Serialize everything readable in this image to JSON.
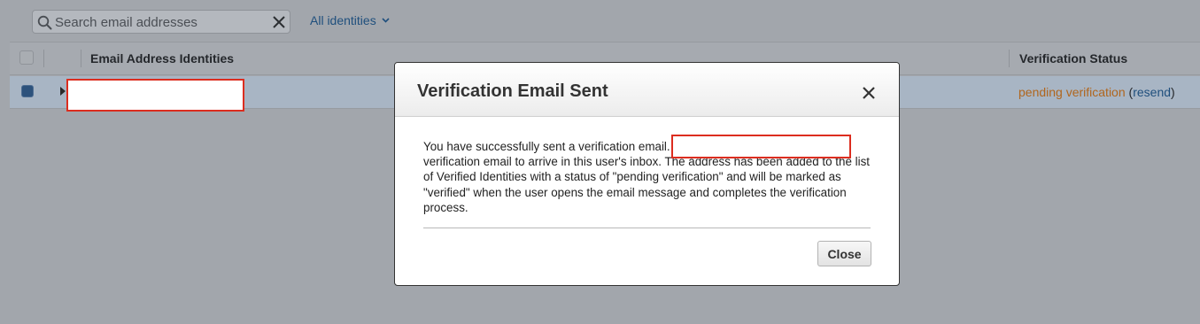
{
  "toolbar": {
    "search_placeholder": "Search email addresses",
    "filter_label": "All identities"
  },
  "table": {
    "columns": [
      "Email Address Identities",
      "Verification Status"
    ],
    "rows": [
      {
        "email": "",
        "status": "pending verification",
        "resend_label": "resend",
        "open_paren": "(",
        "close_paren": ")"
      }
    ]
  },
  "modal": {
    "title": "Verification Email Sent",
    "message": "You have successfully sent a verification email. It may take up to an hour for the verification email to arrive in this user's inbox. The address has been added to the list of Verified Identities with a status of \"pending verification\" and will be marked as \"verified\" when the user opens the email message and completes the verification process.",
    "close_label": "Close"
  },
  "colors": {
    "pending": "#b0661e",
    "link": "#1f4f7d",
    "redaction_border": "#dc2d1f"
  },
  "icons": {
    "search": "magnifier-icon",
    "clear": "close-x-icon",
    "filter": "chevron-down-icon",
    "expand": "caret-right-icon"
  }
}
